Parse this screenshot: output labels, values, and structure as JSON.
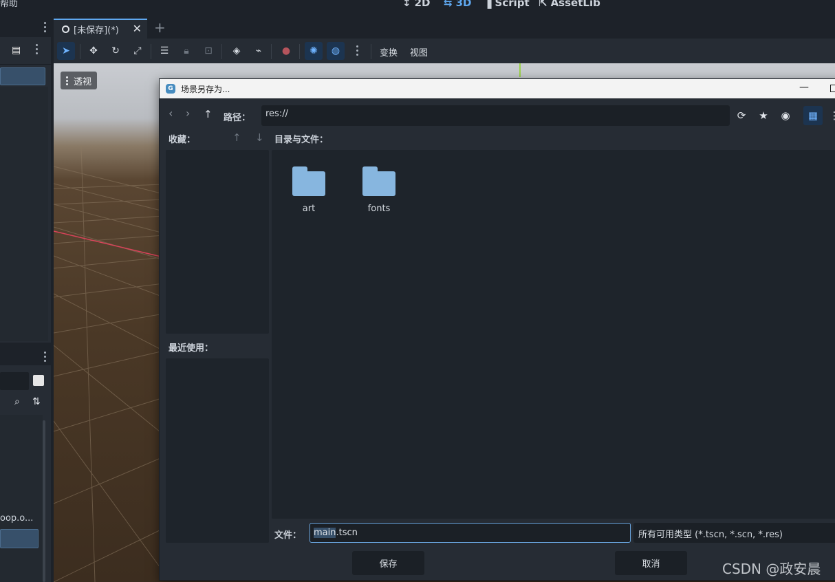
{
  "menu": {
    "help": "帮助"
  },
  "modes": [
    {
      "icon": "2d-icon",
      "glyph": "↕",
      "label": "2D",
      "active": false
    },
    {
      "icon": "3d-icon",
      "glyph": "⇆",
      "label": "3D",
      "active": true
    },
    {
      "icon": "script-icon",
      "glyph": "▐",
      "label": "Script",
      "active": false
    },
    {
      "icon": "assetlib-icon",
      "glyph": "⇱",
      "label": "AssetLib",
      "active": false
    }
  ],
  "left_dock": {
    "file_item": "oop.o..."
  },
  "scene_tab": {
    "title": "[未保存](*)"
  },
  "toolbar": {
    "transform": "变换",
    "view": "视图"
  },
  "viewport": {
    "perspective": "透视"
  },
  "dialog": {
    "title": "场景另存为...",
    "path_label": "路径：",
    "path_value": "res://",
    "favorites_label": "收藏：",
    "dirs_label": "目录与文件：",
    "recent_label": "最近使用：",
    "folders": [
      "art",
      "fonts"
    ],
    "file_label": "文件：",
    "file_name_highlight": "main",
    "file_name_rest": ".tscn",
    "filter": "所有可用类型 (*.tscn, *.scn, *.res)",
    "save": "保存",
    "cancel": "取消"
  },
  "watermark": "CSDN @政安晨",
  "colors": {
    "accent": "#5fa8ef",
    "folder": "#87b6df",
    "panel": "#262c34",
    "x_axis": "#d9435a"
  }
}
